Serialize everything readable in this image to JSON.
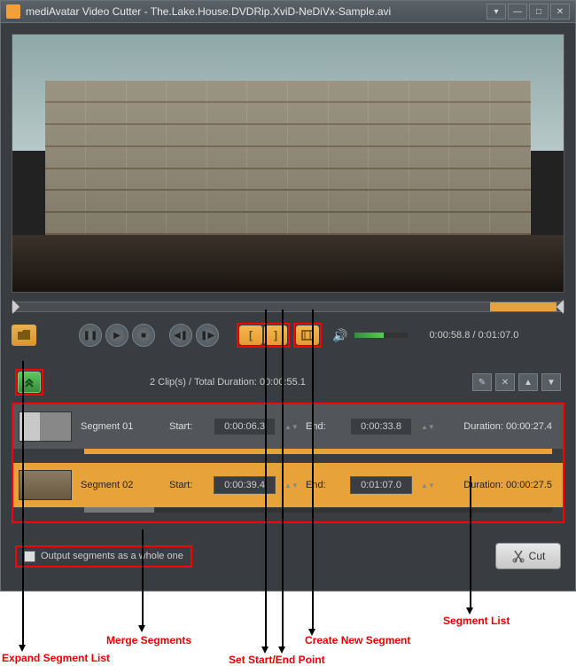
{
  "titlebar": {
    "app_name": "mediAvatar Video Cutter",
    "separator": " - ",
    "file_name": "The.Lake.House.DVDRip.XviD-NeDiVx-Sample.avi"
  },
  "playback": {
    "current_time": "0:00:58.8",
    "total_time": "0:01:07.0"
  },
  "segment_summary": {
    "clip_count": "2 Clip(s)",
    "total_label": "Total Duration:",
    "total_value": "00:00:55.1"
  },
  "segments": [
    {
      "name": "Segment 01",
      "start_label": "Start:",
      "start_value": "0:00:06.3",
      "end_label": "End:",
      "end_value": "0:00:33.8",
      "duration_label": "Duration:",
      "duration_value": "00:00:27.4"
    },
    {
      "name": "Segment 02",
      "start_label": "Start:",
      "start_value": "0:00:39.4",
      "end_label": "End:",
      "end_value": "0:01:07.0",
      "duration_label": "Duration:",
      "duration_value": "00:00:27.5"
    }
  ],
  "footer": {
    "merge_checkbox_label": "Output segments as a whole one",
    "cut_button": "Cut"
  },
  "annotations": {
    "expand": "Expand Segment List",
    "merge": "Merge Segments",
    "startend": "Set Start/End Point",
    "newseg": "Create New Segment",
    "seglist": "Segment List"
  }
}
